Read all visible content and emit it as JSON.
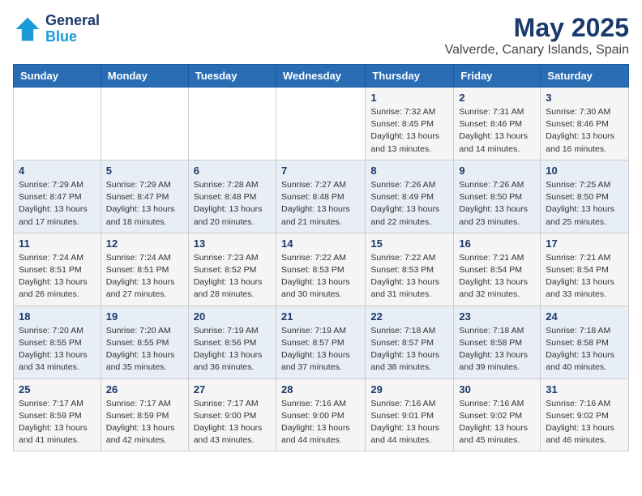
{
  "header": {
    "logo_line1": "General",
    "logo_line2": "Blue",
    "month": "May 2025",
    "location": "Valverde, Canary Islands, Spain"
  },
  "weekdays": [
    "Sunday",
    "Monday",
    "Tuesday",
    "Wednesday",
    "Thursday",
    "Friday",
    "Saturday"
  ],
  "weeks": [
    [
      {
        "day": "",
        "info": ""
      },
      {
        "day": "",
        "info": ""
      },
      {
        "day": "",
        "info": ""
      },
      {
        "day": "",
        "info": ""
      },
      {
        "day": "1",
        "info": "Sunrise: 7:32 AM\nSunset: 8:45 PM\nDaylight: 13 hours\nand 13 minutes."
      },
      {
        "day": "2",
        "info": "Sunrise: 7:31 AM\nSunset: 8:46 PM\nDaylight: 13 hours\nand 14 minutes."
      },
      {
        "day": "3",
        "info": "Sunrise: 7:30 AM\nSunset: 8:46 PM\nDaylight: 13 hours\nand 16 minutes."
      }
    ],
    [
      {
        "day": "4",
        "info": "Sunrise: 7:29 AM\nSunset: 8:47 PM\nDaylight: 13 hours\nand 17 minutes."
      },
      {
        "day": "5",
        "info": "Sunrise: 7:29 AM\nSunset: 8:47 PM\nDaylight: 13 hours\nand 18 minutes."
      },
      {
        "day": "6",
        "info": "Sunrise: 7:28 AM\nSunset: 8:48 PM\nDaylight: 13 hours\nand 20 minutes."
      },
      {
        "day": "7",
        "info": "Sunrise: 7:27 AM\nSunset: 8:48 PM\nDaylight: 13 hours\nand 21 minutes."
      },
      {
        "day": "8",
        "info": "Sunrise: 7:26 AM\nSunset: 8:49 PM\nDaylight: 13 hours\nand 22 minutes."
      },
      {
        "day": "9",
        "info": "Sunrise: 7:26 AM\nSunset: 8:50 PM\nDaylight: 13 hours\nand 23 minutes."
      },
      {
        "day": "10",
        "info": "Sunrise: 7:25 AM\nSunset: 8:50 PM\nDaylight: 13 hours\nand 25 minutes."
      }
    ],
    [
      {
        "day": "11",
        "info": "Sunrise: 7:24 AM\nSunset: 8:51 PM\nDaylight: 13 hours\nand 26 minutes."
      },
      {
        "day": "12",
        "info": "Sunrise: 7:24 AM\nSunset: 8:51 PM\nDaylight: 13 hours\nand 27 minutes."
      },
      {
        "day": "13",
        "info": "Sunrise: 7:23 AM\nSunset: 8:52 PM\nDaylight: 13 hours\nand 28 minutes."
      },
      {
        "day": "14",
        "info": "Sunrise: 7:22 AM\nSunset: 8:53 PM\nDaylight: 13 hours\nand 30 minutes."
      },
      {
        "day": "15",
        "info": "Sunrise: 7:22 AM\nSunset: 8:53 PM\nDaylight: 13 hours\nand 31 minutes."
      },
      {
        "day": "16",
        "info": "Sunrise: 7:21 AM\nSunset: 8:54 PM\nDaylight: 13 hours\nand 32 minutes."
      },
      {
        "day": "17",
        "info": "Sunrise: 7:21 AM\nSunset: 8:54 PM\nDaylight: 13 hours\nand 33 minutes."
      }
    ],
    [
      {
        "day": "18",
        "info": "Sunrise: 7:20 AM\nSunset: 8:55 PM\nDaylight: 13 hours\nand 34 minutes."
      },
      {
        "day": "19",
        "info": "Sunrise: 7:20 AM\nSunset: 8:55 PM\nDaylight: 13 hours\nand 35 minutes."
      },
      {
        "day": "20",
        "info": "Sunrise: 7:19 AM\nSunset: 8:56 PM\nDaylight: 13 hours\nand 36 minutes."
      },
      {
        "day": "21",
        "info": "Sunrise: 7:19 AM\nSunset: 8:57 PM\nDaylight: 13 hours\nand 37 minutes."
      },
      {
        "day": "22",
        "info": "Sunrise: 7:18 AM\nSunset: 8:57 PM\nDaylight: 13 hours\nand 38 minutes."
      },
      {
        "day": "23",
        "info": "Sunrise: 7:18 AM\nSunset: 8:58 PM\nDaylight: 13 hours\nand 39 minutes."
      },
      {
        "day": "24",
        "info": "Sunrise: 7:18 AM\nSunset: 8:58 PM\nDaylight: 13 hours\nand 40 minutes."
      }
    ],
    [
      {
        "day": "25",
        "info": "Sunrise: 7:17 AM\nSunset: 8:59 PM\nDaylight: 13 hours\nand 41 minutes."
      },
      {
        "day": "26",
        "info": "Sunrise: 7:17 AM\nSunset: 8:59 PM\nDaylight: 13 hours\nand 42 minutes."
      },
      {
        "day": "27",
        "info": "Sunrise: 7:17 AM\nSunset: 9:00 PM\nDaylight: 13 hours\nand 43 minutes."
      },
      {
        "day": "28",
        "info": "Sunrise: 7:16 AM\nSunset: 9:00 PM\nDaylight: 13 hours\nand 44 minutes."
      },
      {
        "day": "29",
        "info": "Sunrise: 7:16 AM\nSunset: 9:01 PM\nDaylight: 13 hours\nand 44 minutes."
      },
      {
        "day": "30",
        "info": "Sunrise: 7:16 AM\nSunset: 9:02 PM\nDaylight: 13 hours\nand 45 minutes."
      },
      {
        "day": "31",
        "info": "Sunrise: 7:16 AM\nSunset: 9:02 PM\nDaylight: 13 hours\nand 46 minutes."
      }
    ]
  ]
}
